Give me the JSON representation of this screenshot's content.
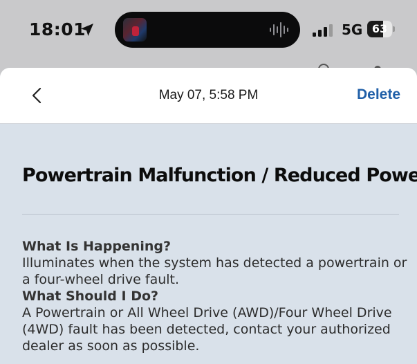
{
  "status_bar": {
    "time": "18:01",
    "network": "5G",
    "battery": "63",
    "battery_level": 0.63,
    "icons": [
      "location-arrow-icon",
      "signal-bars-icon",
      "battery-icon",
      "audio-waveform-icon"
    ]
  },
  "nav": {
    "back_icon": "chevron-left-icon",
    "title": "May 07, 5:58 PM",
    "delete_label": "Delete"
  },
  "message": {
    "title": "Powertrain Malfunction / Reduced Power",
    "sections": [
      {
        "heading": "What Is Happening?",
        "text": "Illuminates when the system has detected a powertrain or a four-wheel drive fault."
      },
      {
        "heading": "What Should I Do?",
        "text": "A Powertrain or All Wheel Drive (AWD)/Four Wheel Drive (4WD) fault has been detected, contact your authorized dealer as soon as possible."
      }
    ]
  },
  "colors": {
    "accent": "#1f5fa8",
    "sheet_background": "#d9e1ea",
    "nav_background": "#ffffff",
    "status_background": "#c9c9cb"
  }
}
